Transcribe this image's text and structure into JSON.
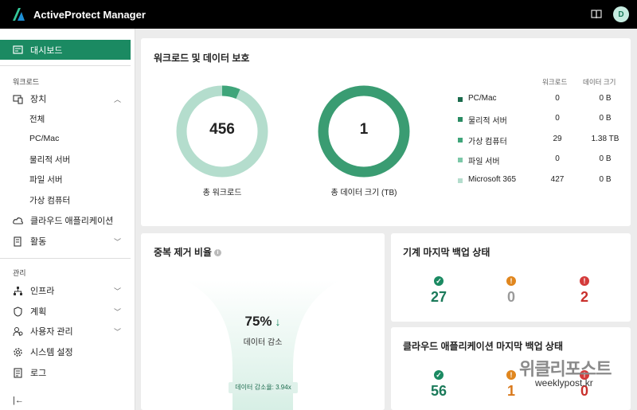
{
  "app": {
    "title": "ActiveProtect Manager",
    "avatar_letter": "D"
  },
  "sidebar": {
    "dashboard": "대시보드",
    "workload_section": "워크로드",
    "devices": "장치",
    "device_subitems": [
      "전체",
      "PC/Mac",
      "물리적 서버",
      "파일 서버",
      "가상 컴퓨터"
    ],
    "cloud_apps": "클라우드 애플리케이션",
    "activity": "활동",
    "manage_section": "관리",
    "infra": "인프라",
    "plans": "계획",
    "user_mgmt": "사용자 관리",
    "system_settings": "시스템 설정",
    "logs": "로그",
    "collapse": "|←"
  },
  "protection": {
    "title": "워크로드 및 데이터 보호",
    "workload_count": "456",
    "workload_caption": "총 워크로드",
    "data_size": "1",
    "data_caption": "총 데이터 크기 (TB)",
    "col_workloads": "워크로드",
    "col_size": "데이터 크기",
    "rows": [
      {
        "name": "PC/Mac",
        "workloads": "0",
        "size": "0 B",
        "color": "#1b6b4d"
      },
      {
        "name": "물리적 서버",
        "workloads": "0",
        "size": "0 B",
        "color": "#2a8c63"
      },
      {
        "name": "가상 컴퓨터",
        "workloads": "29",
        "size": "1.38 TB",
        "color": "#3fa57a"
      },
      {
        "name": "파일 서버",
        "workloads": "0",
        "size": "0 B",
        "color": "#7cc8a8"
      },
      {
        "name": "Microsoft 365",
        "workloads": "427",
        "size": "0 B",
        "color": "#b4ddcd"
      }
    ],
    "workload_share": 0.064
  },
  "dedupe": {
    "title": "중복 제거 비율",
    "info": "i",
    "percent": "75%",
    "arrow": "↓",
    "caption": "데이터 감소",
    "ratio": "데이터 감소율: 3.94x"
  },
  "machine_backup": {
    "title": "기계 마지막 백업 상태",
    "ok": "27",
    "warn": "0",
    "err": "2"
  },
  "cloud_backup": {
    "title": "클라우드 애플리케이션 마지막 백업 상태",
    "ok": "56",
    "warn": "1",
    "err": "0"
  },
  "watermark": {
    "logo": "위클리포스트",
    "url": "weeklypost.kr"
  },
  "colors": {
    "accent": "#1b8a62",
    "warning": "#e0861e",
    "error": "#d43b3b"
  }
}
